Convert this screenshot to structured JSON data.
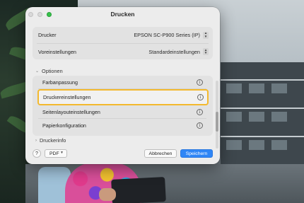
{
  "dialog": {
    "title": "Drucken",
    "printer": {
      "label": "Drucker",
      "value": "EPSON SC-P900 Series (IP)"
    },
    "presets": {
      "label": "Voreinstellungen",
      "value": "Standardeinstellungen"
    },
    "sections": {
      "options_label": "Optionen",
      "printer_info_label": "Druckerinfo"
    },
    "options": [
      {
        "label": "Farbanpassung",
        "selected": false
      },
      {
        "label": "Druckereinstellungen",
        "selected": true
      },
      {
        "label": "Seitenlayouteinstellungen",
        "selected": false
      },
      {
        "label": "Papierkonfiguration",
        "selected": false
      }
    ],
    "footer": {
      "help": "?",
      "pdf": "PDF",
      "cancel": "Abbrechen",
      "save": "Speichern"
    }
  },
  "icons": {
    "info": "ⓘ",
    "stepper_up": "▲",
    "stepper_down": "▼",
    "chevron_down": "⌄"
  },
  "colors": {
    "accent": "#2f86f6",
    "selection_outline": "#f3b92e",
    "zoom_button": "#36c24a"
  }
}
